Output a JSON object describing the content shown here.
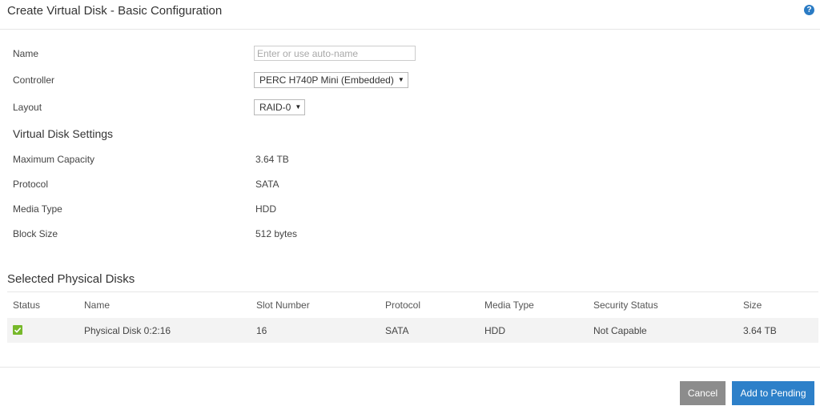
{
  "dialog": {
    "title": "Create Virtual Disk - Basic Configuration",
    "help_icon": "?"
  },
  "form": {
    "name": {
      "label": "Name",
      "value": "",
      "placeholder": "Enter or use auto-name"
    },
    "controller": {
      "label": "Controller",
      "selected": "PERC H740P Mini (Embedded)"
    },
    "layout": {
      "label": "Layout",
      "selected": "RAID-0"
    }
  },
  "settings": {
    "heading": "Virtual Disk Settings",
    "maximum_capacity": {
      "label": "Maximum Capacity",
      "value": "3.64 TB"
    },
    "protocol": {
      "label": "Protocol",
      "value": "SATA"
    },
    "media_type": {
      "label": "Media Type",
      "value": "HDD"
    },
    "block_size": {
      "label": "Block Size",
      "value": "512 bytes"
    }
  },
  "physical_disks": {
    "heading": "Selected Physical Disks",
    "columns": [
      "Status",
      "Name",
      "Slot Number",
      "Protocol",
      "Media Type",
      "Security Status",
      "Size"
    ],
    "rows": [
      {
        "status_icon": "check-icon",
        "name": "Physical Disk 0:2:16",
        "slot": "16",
        "protocol": "SATA",
        "media_type": "HDD",
        "security_status": "Not Capable",
        "size": "3.64 TB"
      }
    ]
  },
  "footer": {
    "cancel_label": "Cancel",
    "add_label": "Add to Pending"
  },
  "colors": {
    "primary_button": "#2d80c9",
    "secondary_button": "#8c8c8c",
    "status_ok": "#76b82a",
    "help_icon": "#2a7bc4"
  }
}
